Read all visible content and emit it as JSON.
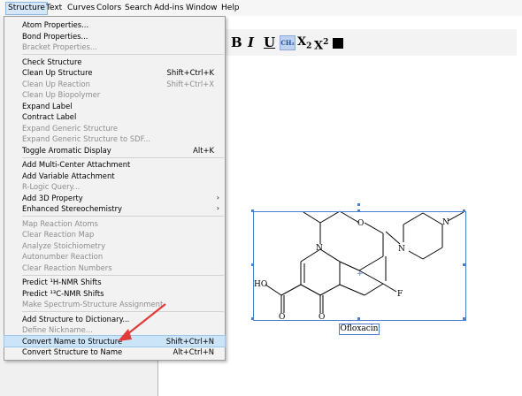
{
  "menubar": {
    "items": [
      "Structure",
      "Text",
      "Curves",
      "Colors",
      "Search",
      "Add-ins",
      "Window",
      "Help"
    ]
  },
  "menu": {
    "items": [
      {
        "label": "Atom Properties...",
        "enabled": true
      },
      {
        "label": "Bond Properties...",
        "enabled": true
      },
      {
        "label": "Bracket Properties...",
        "enabled": false
      },
      {
        "separator": true
      },
      {
        "label": "Check Structure",
        "enabled": true
      },
      {
        "label": "Clean Up Structure",
        "shortcut": "Shift+Ctrl+K",
        "enabled": true
      },
      {
        "label": "Clean Up Reaction",
        "shortcut": "Shift+Ctrl+X",
        "enabled": false
      },
      {
        "label": "Clean Up Biopolymer",
        "enabled": false
      },
      {
        "label": "Expand Label",
        "enabled": true
      },
      {
        "label": "Contract Label",
        "enabled": true
      },
      {
        "label": "Expand Generic Structure",
        "enabled": false
      },
      {
        "label": "Expand Generic Structure to SDF...",
        "enabled": false
      },
      {
        "label": "Toggle Aromatic Display",
        "shortcut": "Alt+K",
        "enabled": true
      },
      {
        "separator": true
      },
      {
        "label": "Add Multi-Center Attachment",
        "enabled": true
      },
      {
        "label": "Add Variable Attachment",
        "enabled": true
      },
      {
        "label": "R-Logic Query...",
        "enabled": false
      },
      {
        "label": "Add 3D Property",
        "submenu": true,
        "enabled": true
      },
      {
        "label": "Enhanced Stereochemistry",
        "submenu": true,
        "enabled": true
      },
      {
        "separator": true
      },
      {
        "label": "Map Reaction Atoms",
        "enabled": false
      },
      {
        "label": "Clear Reaction Map",
        "enabled": false
      },
      {
        "label": "Analyze Stoichiometry",
        "enabled": false
      },
      {
        "label": "Autonumber Reaction",
        "enabled": false
      },
      {
        "label": "Clear Reaction Numbers",
        "enabled": false
      },
      {
        "separator": true
      },
      {
        "label": "Predict ¹H-NMR Shifts",
        "enabled": true
      },
      {
        "label": "Predict ¹³C-NMR Shifts",
        "enabled": true
      },
      {
        "label": "Make Spectrum-Structure Assignment",
        "enabled": false
      },
      {
        "separator": true
      },
      {
        "label": "Add Structure to Dictionary...",
        "enabled": true
      },
      {
        "label": "Define Nickname...",
        "enabled": false
      },
      {
        "label": "Convert Name to Structure",
        "shortcut": "Shift+Ctrl+N",
        "enabled": true,
        "highlighted": true
      },
      {
        "label": "Convert Structure to Name",
        "shortcut": "Alt+Ctrl+N",
        "enabled": true
      }
    ]
  },
  "toolbar": {
    "bold": "B",
    "italic": "I",
    "underline": "U",
    "chem": "CH₂",
    "subscript_base": "X",
    "subscript": "2",
    "superscript_base": "X",
    "superscript": "2"
  },
  "molecule": {
    "name": "Ofloxacin",
    "atoms": {
      "n_ring": "N",
      "o_ring": "O",
      "n_pip1": "N",
      "n_pip2": "N",
      "f": "F",
      "oh": "HO",
      "o_acid": "O",
      "o_keto": "O"
    }
  },
  "colors": {
    "selection": "#4a7fd1",
    "annotation_arrow": "#e23a3a",
    "highlight": "#cce4f7"
  }
}
